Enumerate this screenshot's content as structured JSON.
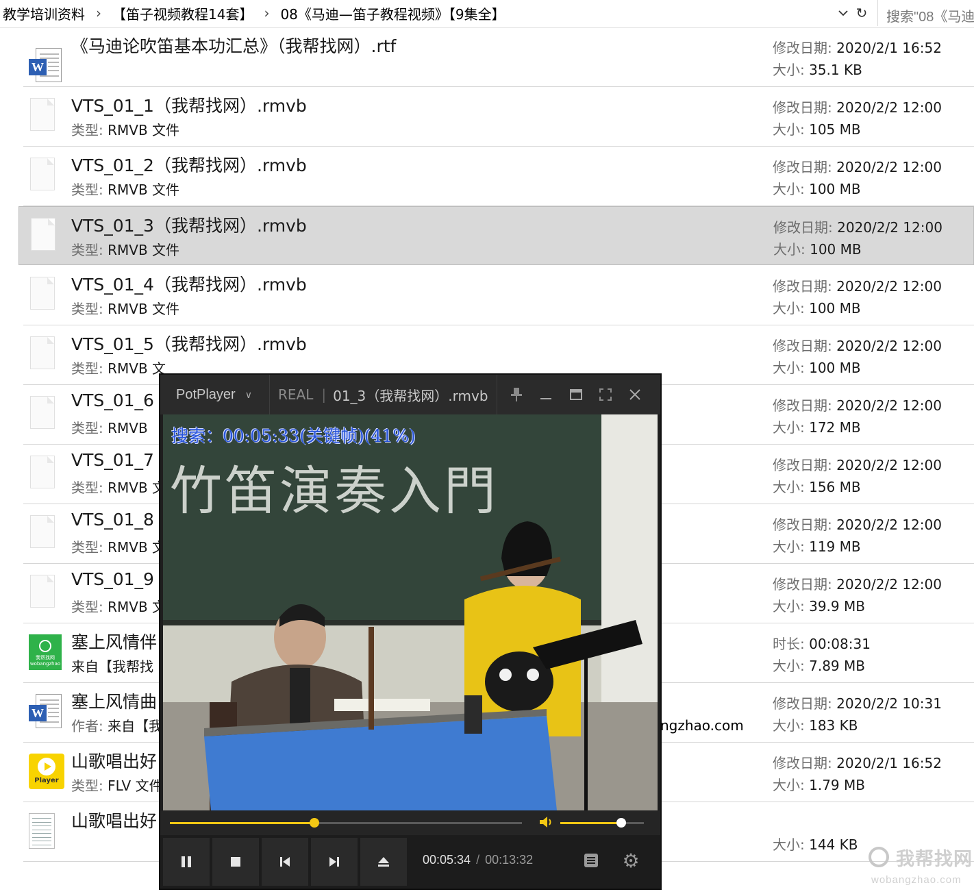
{
  "address_bar": {
    "crumbs": [
      "教学培训资料",
      "【笛子视频教程14套】",
      "08《马迪—笛子教程视频》【9集全】"
    ],
    "search_placeholder": "搜索\"08《马迪"
  },
  "files": [
    {
      "name": "《马迪论吹笛基本功汇总》（我帮找网）.rtf",
      "icon": "word-document-icon",
      "sub_label": "",
      "sub_value": "",
      "meta1_label": "修改日期:",
      "meta1_value": "2020/2/1 16:52",
      "meta2_label": "大小:",
      "meta2_value": "35.1 KB"
    },
    {
      "name": "VTS_01_1（我帮找网）.rmvb",
      "icon": "blank-file-icon",
      "sub_label": "类型:",
      "sub_value": "RMVB 文件",
      "meta1_label": "修改日期:",
      "meta1_value": "2020/2/2 12:00",
      "meta2_label": "大小:",
      "meta2_value": "105 MB"
    },
    {
      "name": "VTS_01_2（我帮找网）.rmvb",
      "icon": "blank-file-icon",
      "sub_label": "类型:",
      "sub_value": "RMVB 文件",
      "meta1_label": "修改日期:",
      "meta1_value": "2020/2/2 12:00",
      "meta2_label": "大小:",
      "meta2_value": "100 MB"
    },
    {
      "name": "VTS_01_3（我帮找网）.rmvb",
      "icon": "blank-file-icon",
      "sub_label": "类型:",
      "sub_value": "RMVB 文件",
      "meta1_label": "修改日期:",
      "meta1_value": "2020/2/2 12:00",
      "meta2_label": "大小:",
      "meta2_value": "100 MB",
      "selected": true
    },
    {
      "name": "VTS_01_4（我帮找网）.rmvb",
      "icon": "blank-file-icon",
      "sub_label": "类型:",
      "sub_value": "RMVB 文件",
      "meta1_label": "修改日期:",
      "meta1_value": "2020/2/2 12:00",
      "meta2_label": "大小:",
      "meta2_value": "100 MB"
    },
    {
      "name": "VTS_01_5（我帮找网）.rmvb",
      "icon": "blank-file-icon",
      "sub_label": "类型:",
      "sub_value": "RMVB 文",
      "meta1_label": "修改日期:",
      "meta1_value": "2020/2/2 12:00",
      "meta2_label": "大小:",
      "meta2_value": "100 MB"
    },
    {
      "name": "VTS_01_6",
      "icon": "blank-file-icon",
      "sub_label": "类型:",
      "sub_value": "RMVB",
      "meta1_label": "修改日期:",
      "meta1_value": "2020/2/2 12:00",
      "meta2_label": "大小:",
      "meta2_value": "172 MB"
    },
    {
      "name": "VTS_01_7",
      "icon": "blank-file-icon",
      "sub_label": "类型:",
      "sub_value": "RMVB 文",
      "meta1_label": "修改日期:",
      "meta1_value": "2020/2/2 12:00",
      "meta2_label": "大小:",
      "meta2_value": "156 MB"
    },
    {
      "name": "VTS_01_8",
      "icon": "blank-file-icon",
      "sub_label": "类型:",
      "sub_value": "RMVB 文",
      "meta1_label": "修改日期:",
      "meta1_value": "2020/2/2 12:00",
      "meta2_label": "大小:",
      "meta2_value": "119 MB"
    },
    {
      "name": "VTS_01_9",
      "icon": "blank-file-icon",
      "sub_label": "类型:",
      "sub_value": "RMVB 文",
      "meta1_label": "修改日期:",
      "meta1_value": "2020/2/2 12:00",
      "meta2_label": "大小:",
      "meta2_value": "39.9 MB"
    },
    {
      "name": "塞上风情伴",
      "icon": "green-video-thumbnail-icon",
      "sub_label": "",
      "sub_value": "来自【我帮找",
      "meta1_label": "时长:",
      "meta1_value": "00:08:31",
      "meta2_label": "大小:",
      "meta2_value": "7.89 MB"
    },
    {
      "name": "塞上风情曲",
      "icon": "word-document-icon",
      "sub_label": "作者:",
      "sub_value": "来自【我",
      "extra": "ngzhao.com",
      "meta1_label": "修改日期:",
      "meta1_value": "2020/2/2 10:31",
      "meta2_label": "大小:",
      "meta2_value": "183 KB"
    },
    {
      "name": "山歌唱出好",
      "icon": "flv-player-icon",
      "sub_label": "类型:",
      "sub_value": "FLV 文件",
      "meta1_label": "修改日期:",
      "meta1_value": "2020/2/1 16:52",
      "meta2_label": "大小:",
      "meta2_value": "1.79 MB"
    },
    {
      "name": "山歌唱出好",
      "icon": "sheet-music-icon",
      "sub_label": "",
      "sub_value": "",
      "meta1_label": "",
      "meta1_value": "",
      "meta2_label": "大小:",
      "meta2_value": "144 KB"
    }
  ],
  "player": {
    "brand": "PotPlayer",
    "title_prefix": "REAL",
    "title": "01_3（我帮找网）.rmvb",
    "osd": "搜索：00:05:33(关键帧)(41%)",
    "blackboard_text": "竹笛演奏入門",
    "seek_progress": 0.41,
    "volume_level": 0.73,
    "current_time": "00:05:34",
    "total_time": "00:13:32",
    "accent_color": "#f3c814"
  },
  "watermark": {
    "title": "我帮找网",
    "url": "wobangzhao.com"
  }
}
